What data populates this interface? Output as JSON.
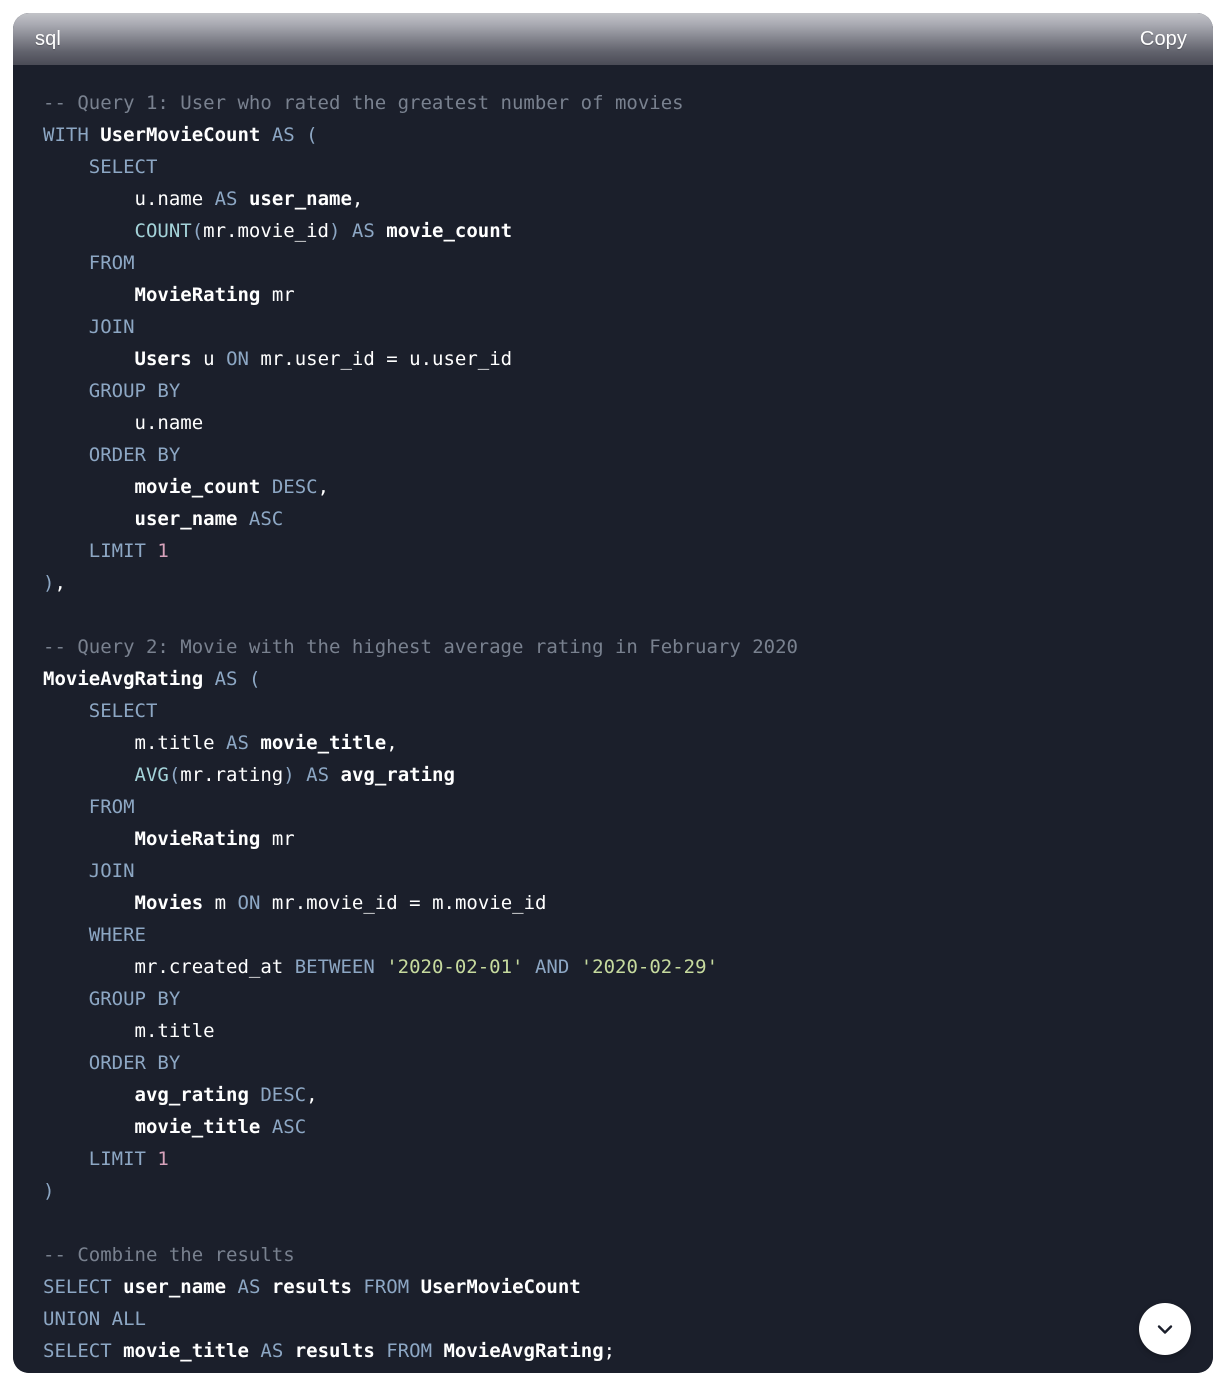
{
  "code_block": {
    "language_label": "sql",
    "copy_label": "Copy",
    "scroll_button_icon": "chevron-down-icon",
    "colors": {
      "card_background": "#1b1f2b",
      "header_gradient_top": "#c2c3c8",
      "header_gradient_bottom": "#4a4b56",
      "page_background": "#ffffff",
      "comment": "#79818f",
      "keyword": "#8da7c4",
      "identifier": "#ffffff",
      "function": "#a4d3d9",
      "string": "#c6da9e",
      "number": "#d7a2bb",
      "fab_background": "#ffffff",
      "fab_icon": "#1b1f2b"
    },
    "code_plain": "-- Query 1: User who rated the greatest number of movies\nWITH UserMovieCount AS (\n    SELECT\n        u.name AS user_name,\n        COUNT(mr.movie_id) AS movie_count\n    FROM\n        MovieRating mr\n    JOIN\n        Users u ON mr.user_id = u.user_id\n    GROUP BY\n        u.name\n    ORDER BY\n        movie_count DESC,\n        user_name ASC\n    LIMIT 1\n),\n\n-- Query 2: Movie with the highest average rating in February 2020\nMovieAvgRating AS (\n    SELECT\n        m.title AS movie_title,\n        AVG(mr.rating) AS avg_rating\n    FROM\n        MovieRating mr\n    JOIN\n        Movies m ON mr.movie_id = m.movie_id\n    WHERE\n        mr.created_at BETWEEN '2020-02-01' AND '2020-02-29'\n    GROUP BY\n        m.title\n    ORDER BY\n        avg_rating DESC,\n        movie_title ASC\n    LIMIT 1\n)\n\n-- Combine the results\nSELECT user_name AS results FROM UserMovieCount\nUNION ALL\nSELECT movie_title AS results FROM MovieAvgRating;",
    "lines": [
      {
        "n": 1,
        "text": "-- Query 1: User who rated the greatest number of movies"
      },
      {
        "n": 2,
        "text": "WITH UserMovieCount AS ("
      },
      {
        "n": 3,
        "text": "    SELECT"
      },
      {
        "n": 4,
        "text": "        u.name AS user_name,"
      },
      {
        "n": 5,
        "text": "        COUNT(mr.movie_id) AS movie_count"
      },
      {
        "n": 6,
        "text": "    FROM"
      },
      {
        "n": 7,
        "text": "        MovieRating mr"
      },
      {
        "n": 8,
        "text": "    JOIN"
      },
      {
        "n": 9,
        "text": "        Users u ON mr.user_id = u.user_id"
      },
      {
        "n": 10,
        "text": "    GROUP BY"
      },
      {
        "n": 11,
        "text": "        u.name"
      },
      {
        "n": 12,
        "text": "    ORDER BY"
      },
      {
        "n": 13,
        "text": "        movie_count DESC,"
      },
      {
        "n": 14,
        "text": "        user_name ASC"
      },
      {
        "n": 15,
        "text": "    LIMIT 1"
      },
      {
        "n": 16,
        "text": "),"
      },
      {
        "n": 17,
        "text": ""
      },
      {
        "n": 18,
        "text": "-- Query 2: Movie with the highest average rating in February 2020"
      },
      {
        "n": 19,
        "text": "MovieAvgRating AS ("
      },
      {
        "n": 20,
        "text": "    SELECT"
      },
      {
        "n": 21,
        "text": "        m.title AS movie_title,"
      },
      {
        "n": 22,
        "text": "        AVG(mr.rating) AS avg_rating"
      },
      {
        "n": 23,
        "text": "    FROM"
      },
      {
        "n": 24,
        "text": "        MovieRating mr"
      },
      {
        "n": 25,
        "text": "    JOIN"
      },
      {
        "n": 26,
        "text": "        Movies m ON mr.movie_id = m.movie_id"
      },
      {
        "n": 27,
        "text": "    WHERE"
      },
      {
        "n": 28,
        "text": "        mr.created_at BETWEEN '2020-02-01' AND '2020-02-29'"
      },
      {
        "n": 29,
        "text": "    GROUP BY"
      },
      {
        "n": 30,
        "text": "        m.title"
      },
      {
        "n": 31,
        "text": "    ORDER BY"
      },
      {
        "n": 32,
        "text": "        avg_rating DESC,"
      },
      {
        "n": 33,
        "text": "        movie_title ASC"
      },
      {
        "n": 34,
        "text": "    LIMIT 1"
      },
      {
        "n": 35,
        "text": ")"
      },
      {
        "n": 36,
        "text": ""
      },
      {
        "n": 37,
        "text": "-- Combine the results"
      },
      {
        "n": 38,
        "text": "SELECT user_name AS results FROM UserMovieCount"
      },
      {
        "n": 39,
        "text": "UNION ALL"
      },
      {
        "n": 40,
        "text": "SELECT movie_title AS results FROM MovieAvgRating;"
      }
    ]
  }
}
